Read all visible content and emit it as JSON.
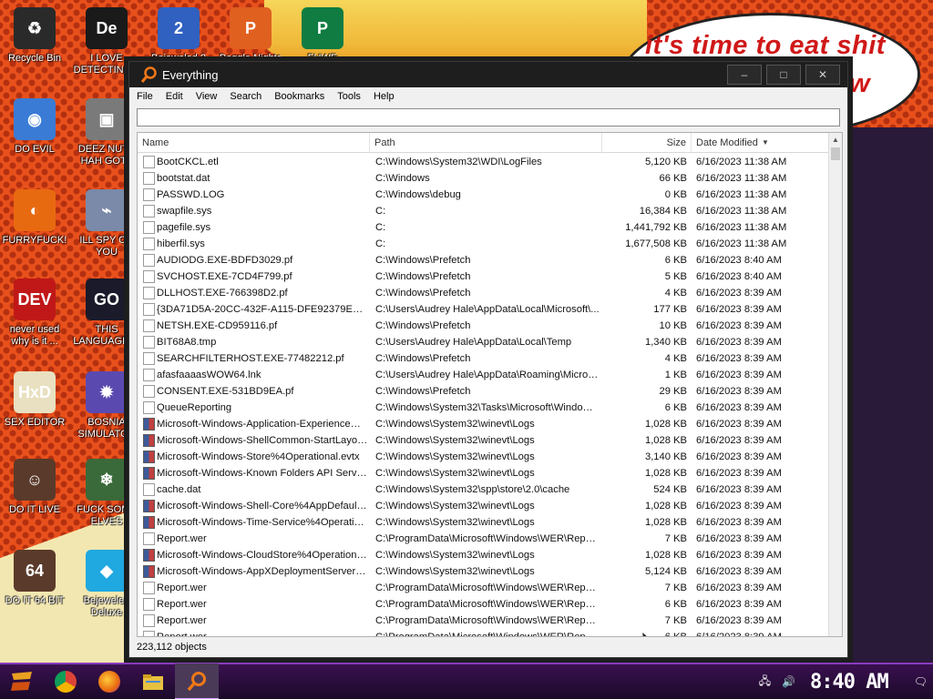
{
  "wallpaper": {
    "bubble_line1": "it's time to eat shit",
    "bubble_line2": "w"
  },
  "desktop_icons": [
    {
      "label": "Recycle Bin",
      "icon": "recycle-bin-icon",
      "color": "#2a2a2a",
      "glyph": "♻"
    },
    {
      "label": "I LOVE DETECTING...",
      "icon": "detect-it-easy-icon",
      "color": "#1a1a1a",
      "glyph": "De"
    },
    {
      "label": "Bejeweled 2",
      "icon": "bejeweled-2-icon",
      "color": "#3060c0",
      "glyph": "2"
    },
    {
      "label": "Peggle Nights",
      "icon": "peggle-icon",
      "color": "#e06020",
      "glyph": "P"
    },
    {
      "label": "FUWE",
      "icon": "publisher-icon",
      "color": "#107c41",
      "glyph": "P"
    },
    {
      "label": "DO EVIL",
      "icon": "chrome-icon",
      "color": "#3a7bd5",
      "glyph": "◉"
    },
    {
      "label": "DEEZ NUTS HAH GOTT",
      "icon": "file-copy-icon",
      "color": "#7a7a7a",
      "glyph": "▣"
    },
    {
      "label": "FURRYFUCK!",
      "icon": "firefox-icon",
      "color": "#e86a10",
      "glyph": "◐"
    },
    {
      "label": "ILL SPY ON YOU",
      "icon": "network-spy-icon",
      "color": "#7a8aa8",
      "glyph": "⌁"
    },
    {
      "label": "never used why is it ...",
      "icon": "dev-cpp-icon",
      "color": "#c01818",
      "glyph": "DEV"
    },
    {
      "label": "THIS LANGUAGE ...",
      "icon": "golang-icon",
      "color": "#1a1a2a",
      "glyph": "GO"
    },
    {
      "label": "SEX EDITOR",
      "icon": "hxd-editor-icon",
      "color": "#e8e0c0",
      "glyph": "HxD"
    },
    {
      "label": "BOSNIA SIMULATOR",
      "icon": "mine-icon",
      "color": "#5a4ab0",
      "glyph": "✹"
    },
    {
      "label": "DO IT LIVE",
      "icon": "portrait-icon",
      "color": "#5a3a2a",
      "glyph": "☺"
    },
    {
      "label": "FUCK SOME ELVES",
      "icon": "elf-game-icon",
      "color": "#3a6a3a",
      "glyph": "❄"
    },
    {
      "label": "DO IT 64 BIT",
      "icon": "portrait-64-icon",
      "color": "#5a3a2a",
      "glyph": "64"
    },
    {
      "label": "Bejeweled Deluxe",
      "icon": "diamond-icon",
      "color": "#20a8e0",
      "glyph": "◆"
    }
  ],
  "window": {
    "title": "Everything",
    "controls": {
      "minimize": "–",
      "maximize": "□",
      "close": "✕"
    },
    "menu": [
      "File",
      "Edit",
      "View",
      "Search",
      "Bookmarks",
      "Tools",
      "Help"
    ],
    "search": {
      "value": "",
      "placeholder": ""
    },
    "columns": {
      "name": "Name",
      "path": "Path",
      "size": "Size",
      "date": "Date Modified"
    },
    "rows": [
      {
        "icon": "file",
        "name": "BootCKCL.etl",
        "path": "C:\\Windows\\System32\\WDI\\LogFiles",
        "size": "5,120 KB",
        "date": "6/16/2023 11:38 AM"
      },
      {
        "icon": "file",
        "name": "bootstat.dat",
        "path": "C:\\Windows",
        "size": "66 KB",
        "date": "6/16/2023 11:38 AM"
      },
      {
        "icon": "file",
        "name": "PASSWD.LOG",
        "path": "C:\\Windows\\debug",
        "size": "0 KB",
        "date": "6/16/2023 11:38 AM"
      },
      {
        "icon": "file",
        "name": "swapfile.sys",
        "path": "C:",
        "size": "16,384 KB",
        "date": "6/16/2023 11:38 AM"
      },
      {
        "icon": "file",
        "name": "pagefile.sys",
        "path": "C:",
        "size": "1,441,792 KB",
        "date": "6/16/2023 11:38 AM"
      },
      {
        "icon": "file",
        "name": "hiberfil.sys",
        "path": "C:",
        "size": "1,677,508 KB",
        "date": "6/16/2023 11:38 AM"
      },
      {
        "icon": "file",
        "name": "AUDIODG.EXE-BDFD3029.pf",
        "path": "C:\\Windows\\Prefetch",
        "size": "6 KB",
        "date": "6/16/2023 8:40 AM"
      },
      {
        "icon": "file",
        "name": "SVCHOST.EXE-7CD4F799.pf",
        "path": "C:\\Windows\\Prefetch",
        "size": "5 KB",
        "date": "6/16/2023 8:40 AM"
      },
      {
        "icon": "file",
        "name": "DLLHOST.EXE-766398D2.pf",
        "path": "C:\\Windows\\Prefetch",
        "size": "4 KB",
        "date": "6/16/2023 8:39 AM"
      },
      {
        "icon": "file",
        "name": "{3DA71D5A-20CC-432F-A115-DFE92379E91F}...",
        "path": "C:\\Users\\Audrey Hale\\AppData\\Local\\Microsoft\\...",
        "size": "177 KB",
        "date": "6/16/2023 8:39 AM"
      },
      {
        "icon": "file",
        "name": "NETSH.EXE-CD959116.pf",
        "path": "C:\\Windows\\Prefetch",
        "size": "10 KB",
        "date": "6/16/2023 8:39 AM"
      },
      {
        "icon": "file",
        "name": "BIT68A8.tmp",
        "path": "C:\\Users\\Audrey Hale\\AppData\\Local\\Temp",
        "size": "1,340 KB",
        "date": "6/16/2023 8:39 AM"
      },
      {
        "icon": "file",
        "name": "SEARCHFILTERHOST.EXE-77482212.pf",
        "path": "C:\\Windows\\Prefetch",
        "size": "4 KB",
        "date": "6/16/2023 8:39 AM"
      },
      {
        "icon": "file",
        "name": "afasfaaaasWOW64.lnk",
        "path": "C:\\Users\\Audrey Hale\\AppData\\Roaming\\Micros...",
        "size": "1 KB",
        "date": "6/16/2023 8:39 AM"
      },
      {
        "icon": "file",
        "name": "CONSENT.EXE-531BD9EA.pf",
        "path": "C:\\Windows\\Prefetch",
        "size": "29 KB",
        "date": "6/16/2023 8:39 AM"
      },
      {
        "icon": "file",
        "name": "QueueReporting",
        "path": "C:\\Windows\\System32\\Tasks\\Microsoft\\Windows...",
        "size": "6 KB",
        "date": "6/16/2023 8:39 AM"
      },
      {
        "icon": "log",
        "name": "Microsoft-Windows-Application-Experience%4...",
        "path": "C:\\Windows\\System32\\winevt\\Logs",
        "size": "1,028 KB",
        "date": "6/16/2023 8:39 AM"
      },
      {
        "icon": "log",
        "name": "Microsoft-Windows-ShellCommon-StartLayoutP...",
        "path": "C:\\Windows\\System32\\winevt\\Logs",
        "size": "1,028 KB",
        "date": "6/16/2023 8:39 AM"
      },
      {
        "icon": "log",
        "name": "Microsoft-Windows-Store%4Operational.evtx",
        "path": "C:\\Windows\\System32\\winevt\\Logs",
        "size": "3,140 KB",
        "date": "6/16/2023 8:39 AM"
      },
      {
        "icon": "log",
        "name": "Microsoft-Windows-Known Folders API Service...",
        "path": "C:\\Windows\\System32\\winevt\\Logs",
        "size": "1,028 KB",
        "date": "6/16/2023 8:39 AM"
      },
      {
        "icon": "file",
        "name": "cache.dat",
        "path": "C:\\Windows\\System32\\spp\\store\\2.0\\cache",
        "size": "524 KB",
        "date": "6/16/2023 8:39 AM"
      },
      {
        "icon": "log",
        "name": "Microsoft-Windows-Shell-Core%4AppDefaults....",
        "path": "C:\\Windows\\System32\\winevt\\Logs",
        "size": "1,028 KB",
        "date": "6/16/2023 8:39 AM"
      },
      {
        "icon": "log",
        "name": "Microsoft-Windows-Time-Service%4Operationa...",
        "path": "C:\\Windows\\System32\\winevt\\Logs",
        "size": "1,028 KB",
        "date": "6/16/2023 8:39 AM"
      },
      {
        "icon": "file",
        "name": "Report.wer",
        "path": "C:\\ProgramData\\Microsoft\\Windows\\WER\\Report...",
        "size": "7 KB",
        "date": "6/16/2023 8:39 AM"
      },
      {
        "icon": "log",
        "name": "Microsoft-Windows-CloudStore%4Operational....",
        "path": "C:\\Windows\\System32\\winevt\\Logs",
        "size": "1,028 KB",
        "date": "6/16/2023 8:39 AM"
      },
      {
        "icon": "log",
        "name": "Microsoft-Windows-AppXDeploymentServer%4...",
        "path": "C:\\Windows\\System32\\winevt\\Logs",
        "size": "5,124 KB",
        "date": "6/16/2023 8:39 AM"
      },
      {
        "icon": "file",
        "name": "Report.wer",
        "path": "C:\\ProgramData\\Microsoft\\Windows\\WER\\Report...",
        "size": "7 KB",
        "date": "6/16/2023 8:39 AM"
      },
      {
        "icon": "file",
        "name": "Report.wer",
        "path": "C:\\ProgramData\\Microsoft\\Windows\\WER\\Report...",
        "size": "6 KB",
        "date": "6/16/2023 8:39 AM"
      },
      {
        "icon": "file",
        "name": "Report.wer",
        "path": "C:\\ProgramData\\Microsoft\\Windows\\WER\\Report...",
        "size": "7 KB",
        "date": "6/16/2023 8:39 AM"
      },
      {
        "icon": "file",
        "name": "Report.wer",
        "path": "C:\\ProgramData\\Microsoft\\Windows\\WER\\Report...",
        "size": "6 KB",
        "date": "6/16/2023 8:39 AM"
      }
    ],
    "status": "223,112 objects"
  },
  "taskbar": {
    "apps": [
      {
        "name": "start-button",
        "icon": "start-icon",
        "color": "#e8a020"
      },
      {
        "name": "taskbar-chrome",
        "icon": "chrome-icon",
        "color": "#3a7bd5"
      },
      {
        "name": "taskbar-firefox",
        "icon": "firefox-icon",
        "color": "#e86a10"
      },
      {
        "name": "taskbar-explorer",
        "icon": "folder-icon",
        "color": "#e8c040"
      },
      {
        "name": "taskbar-everything",
        "icon": "everything-icon",
        "color": "#f07818"
      }
    ],
    "tray": {
      "network": "🖧",
      "volume": "🔊",
      "clock": "8:40 AM",
      "notifications": "🗨"
    }
  }
}
